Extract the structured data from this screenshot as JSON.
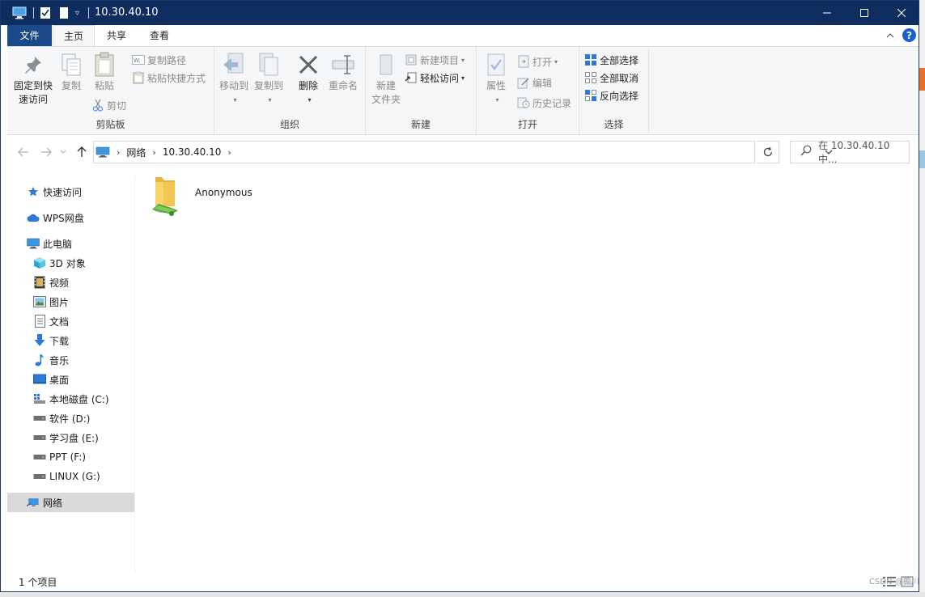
{
  "window": {
    "title": "10.30.40.10"
  },
  "tabs": {
    "file": "文件",
    "home": "主页",
    "share": "共享",
    "view": "查看"
  },
  "ribbon": {
    "clipboard": {
      "pin_line1": "固定到快",
      "pin_line2": "速访问",
      "copy": "复制",
      "paste": "粘贴",
      "copy_path": "复制路径",
      "paste_shortcut": "粘贴快捷方式",
      "cut": "剪切",
      "label": "剪贴板"
    },
    "organize": {
      "move_to": "移动到",
      "copy_to": "复制到",
      "delete": "删除",
      "rename": "重命名",
      "label": "组织"
    },
    "new": {
      "new_folder_line1": "新建",
      "new_folder_line2": "文件夹",
      "new_item": "新建项目",
      "easy_access": "轻松访问",
      "label": "新建"
    },
    "open": {
      "properties": "属性",
      "open": "打开",
      "edit": "编辑",
      "history": "历史记录",
      "label": "打开"
    },
    "select": {
      "select_all": "全部选择",
      "select_none": "全部取消",
      "invert": "反向选择",
      "label": "选择"
    }
  },
  "address": {
    "crumbs": [
      "网络",
      "10.30.40.10"
    ],
    "search_placeholder": "在 10.30.40.10 中..."
  },
  "navpane": {
    "quick_access": "快速访问",
    "wps": "WPS网盘",
    "this_pc": "此电脑",
    "items": [
      "3D 对象",
      "视频",
      "图片",
      "文档",
      "下载",
      "音乐",
      "桌面",
      "本地磁盘 (C:)",
      "软件 (D:)",
      "学习盘 (E:)",
      "PPT (F:)",
      "LINUX (G:)"
    ],
    "network": "网络"
  },
  "content": {
    "items": [
      {
        "name": "Anonymous",
        "icon": "shared-folder-icon"
      }
    ]
  },
  "status": {
    "count": "1 个项目"
  },
  "watermark": "CSDN @孤川",
  "colors": {
    "titlebar": "#0f2d5e",
    "file_tab": "#1a4a8a",
    "ribbon_bg": "#f5f6f7",
    "selected_nav": "#d9d9d9",
    "accent_blue": "#1b62c8"
  }
}
